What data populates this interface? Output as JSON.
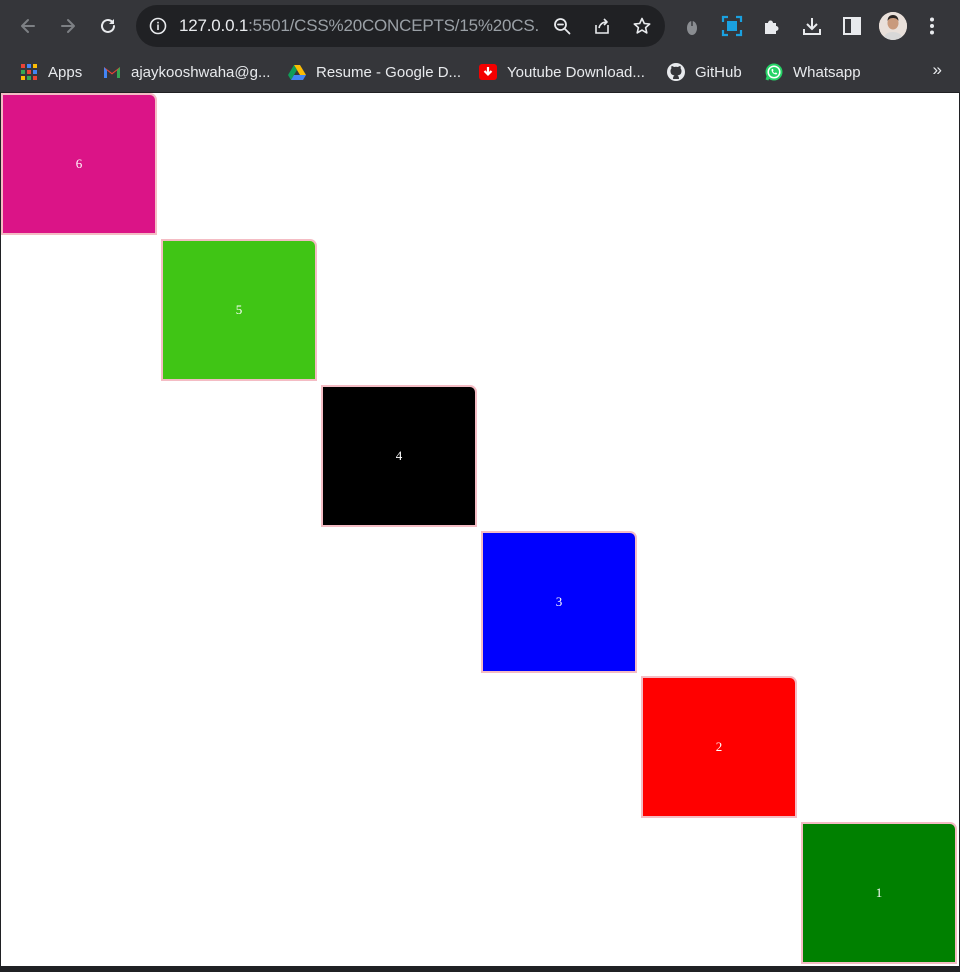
{
  "browser": {
    "url_host": "127.0.0.1",
    "url_rest": ":5501/CSS%20CONCEPTS/15%20CS...",
    "icons": [
      "back-icon",
      "forward-icon",
      "reload-icon",
      "info-icon",
      "zoom-icon",
      "share-icon",
      "star-icon",
      "extension-mouse-icon",
      "screen-capture-icon",
      "extensions-icon",
      "download-icon",
      "side-panel-icon",
      "avatar",
      "menu-icon"
    ]
  },
  "bookmarks": [
    {
      "label": "Apps",
      "icon": "apps-grid-icon"
    },
    {
      "label": "ajaykooshwaha@g...",
      "icon": "gmail-icon"
    },
    {
      "label": "Resume - Google D...",
      "icon": "google-drive-icon"
    },
    {
      "label": "Youtube Download...",
      "icon": "youtube-download-icon"
    },
    {
      "label": "GitHub",
      "icon": "github-icon"
    },
    {
      "label": "Whatsapp",
      "icon": "whatsapp-icon"
    }
  ],
  "bookmarks_overflow": "»",
  "boxes": [
    {
      "label": "6",
      "color": "#db1487"
    },
    {
      "label": "5",
      "color": "#40c515"
    },
    {
      "label": "4",
      "color": "#000000"
    },
    {
      "label": "3",
      "color": "#0000ff"
    },
    {
      "label": "2",
      "color": "#ff0000"
    },
    {
      "label": "1",
      "color": "#008000"
    }
  ]
}
